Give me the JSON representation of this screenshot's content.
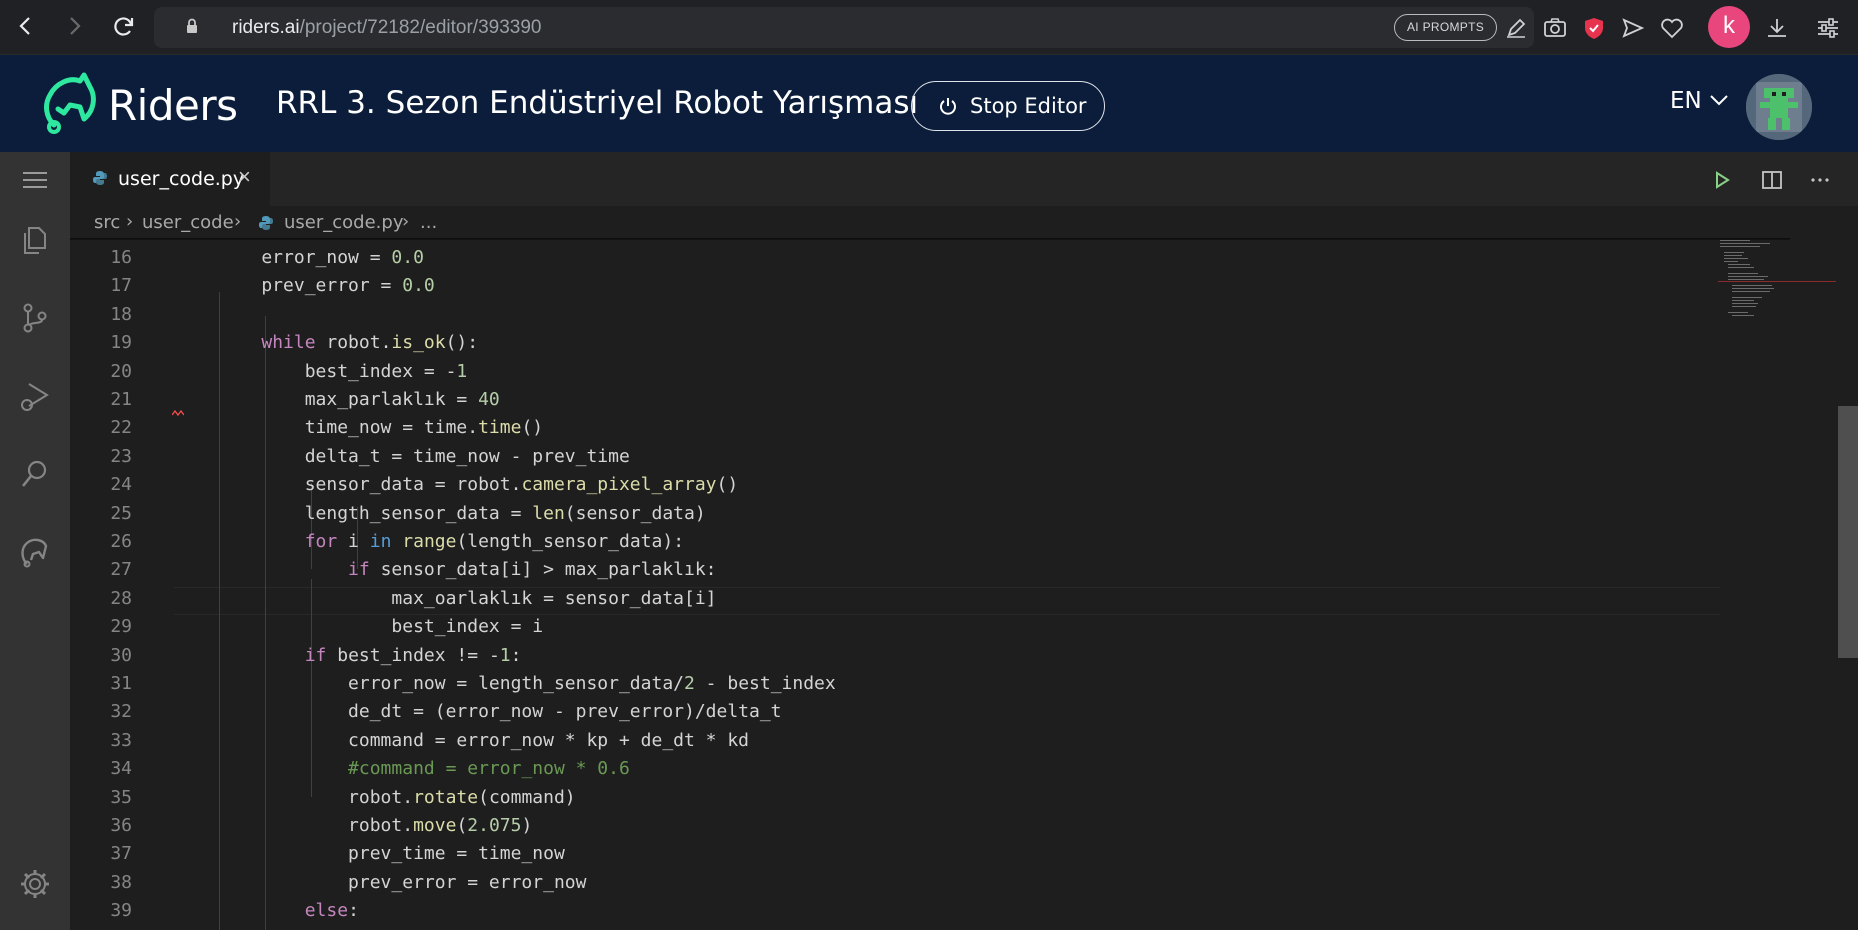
{
  "browser": {
    "url_host": "riders.ai",
    "url_path": "/project/72182/editor/393390",
    "ai_prompts_label": "AI PROMPTS",
    "profile_initial": "k"
  },
  "header": {
    "logo_text": "Riders",
    "title": "RRL 3. Sezon Endüstriyel Robot Yarışması",
    "stop_button_label": "Stop Editor",
    "language": "EN"
  },
  "editor": {
    "tab_label": "user_code.py",
    "breadcrumbs": [
      "src",
      "user_code",
      "user_code.py",
      "..."
    ],
    "lines": [
      {
        "n": "16",
        "html": "    error_now = <span class=\"n\">0.0</span>"
      },
      {
        "n": "17",
        "html": "    prev_error = <span class=\"n\">0.0</span>"
      },
      {
        "n": "18",
        "html": ""
      },
      {
        "n": "19",
        "html": "    <span class=\"k\">while</span> robot.<span class=\"f\">is_ok</span>():"
      },
      {
        "n": "20",
        "html": "        best_index = -<span class=\"n\">1</span>"
      },
      {
        "n": "21",
        "html": "        max_parlaklık = <span class=\"n\">40</span>"
      },
      {
        "n": "22",
        "html": "        time_now = time.<span class=\"f\">time</span>()"
      },
      {
        "n": "23",
        "html": "        delta_t = time_now - prev_time"
      },
      {
        "n": "24",
        "html": "        sensor_data = robot.<span class=\"f\">camera_pixel_array</span>()"
      },
      {
        "n": "25",
        "html": "        length_sensor_data = <span class=\"f\">len</span>(sensor_data)"
      },
      {
        "n": "26",
        "html": "        <span class=\"k\">for</span> i <span class=\"kb\">in</span> <span class=\"f\">range</span>(length_sensor_data):"
      },
      {
        "n": "27",
        "html": "            <span class=\"k\">if</span> sensor_data[i] > max_parlaklık:"
      },
      {
        "n": "28",
        "html": "                max_oarlaklık = sensor_data[i]"
      },
      {
        "n": "29",
        "html": "                best_index = i"
      },
      {
        "n": "30",
        "html": "        <span class=\"k\">if</span> best_index != -<span class=\"n\">1</span>:"
      },
      {
        "n": "31",
        "html": "            error_now = length_sensor_data/<span class=\"n\">2</span> - best_index"
      },
      {
        "n": "32",
        "html": "            de_dt = (error_now - prev_error)/delta_t"
      },
      {
        "n": "33",
        "html": "            command = error_now * kp + de_dt * kd"
      },
      {
        "n": "34",
        "html": "            <span class=\"c\">#command = error_now * 0.6</span>"
      },
      {
        "n": "35",
        "html": "            robot.<span class=\"f\">rotate</span>(command)"
      },
      {
        "n": "36",
        "html": "            robot.<span class=\"f\">move</span>(<span class=\"n\">2.075</span>)"
      },
      {
        "n": "37",
        "html": "            prev_time = time_now"
      },
      {
        "n": "38",
        "html": "            prev_error = error_now"
      },
      {
        "n": "39",
        "html": "        <span class=\"k\">else</span>:"
      }
    ]
  },
  "icons": {
    "back": "arrow-left-icon",
    "forward": "arrow-right-icon",
    "reload": "reload-icon",
    "explorer": "files-icon",
    "source_control": "source-control-icon",
    "run_debug": "run-debug-icon",
    "search": "search-icon",
    "riders": "riders-logo-icon",
    "settings": "gear-icon"
  },
  "colors": {
    "header_bg": "#0b1d3a",
    "logo_accent": "#2ee8a0",
    "keyword": "#c586c0",
    "number": "#b5cea8",
    "function": "#dcdcaa",
    "comment": "#6a9955"
  }
}
